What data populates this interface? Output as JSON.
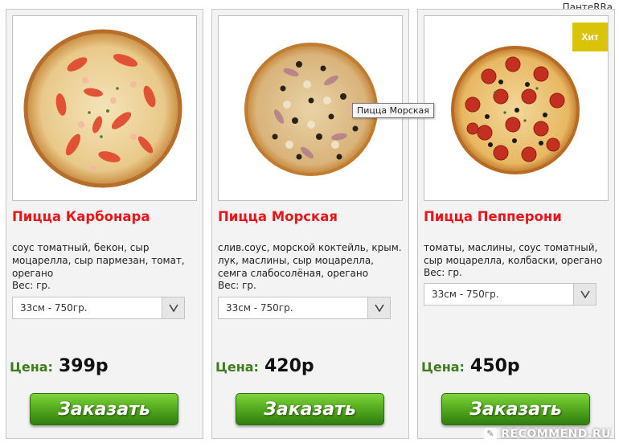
{
  "watermark": {
    "author": "ПантеRRa",
    "site": "RECOMMEND.RU"
  },
  "tooltip": "Пицца Морская",
  "colors": {
    "title": "#e8151b",
    "price_label": "#3f7c1e",
    "button": "#4fa41c",
    "badge": "#d9c40a"
  },
  "products": [
    {
      "title": "Пицца Карбонара",
      "description": "соус томатный, бекон, сыр моцарелла, сыр пармезан, томат, орегано",
      "weight_label": "Вес: гр.",
      "size_option": "33см - 750гр.",
      "price_label": "Цена:",
      "price": "399р",
      "order_label": "Заказать",
      "image_icon": "pizza-carbonara-icon"
    },
    {
      "title": "Пицца Морская",
      "description": "слив.соус, морской коктейль, крым. лук, маслины, сыр моцарелла, семга слабосолёная, орегано",
      "weight_label": "Вес: гр.",
      "size_option": "33см - 750гр.",
      "price_label": "Цена:",
      "price": "420р",
      "order_label": "Заказать",
      "image_icon": "pizza-seafood-icon"
    },
    {
      "title": "Пицца Пепперони",
      "description": "томаты, маслины, соус томатный, сыр моцарелла, колбаски, орегано",
      "weight_label": "Вес: гр.",
      "size_option": "33см - 750гр.",
      "price_label": "Цена:",
      "price": "450р",
      "order_label": "Заказать",
      "badge": "Хит",
      "image_icon": "pizza-pepperoni-icon"
    }
  ]
}
